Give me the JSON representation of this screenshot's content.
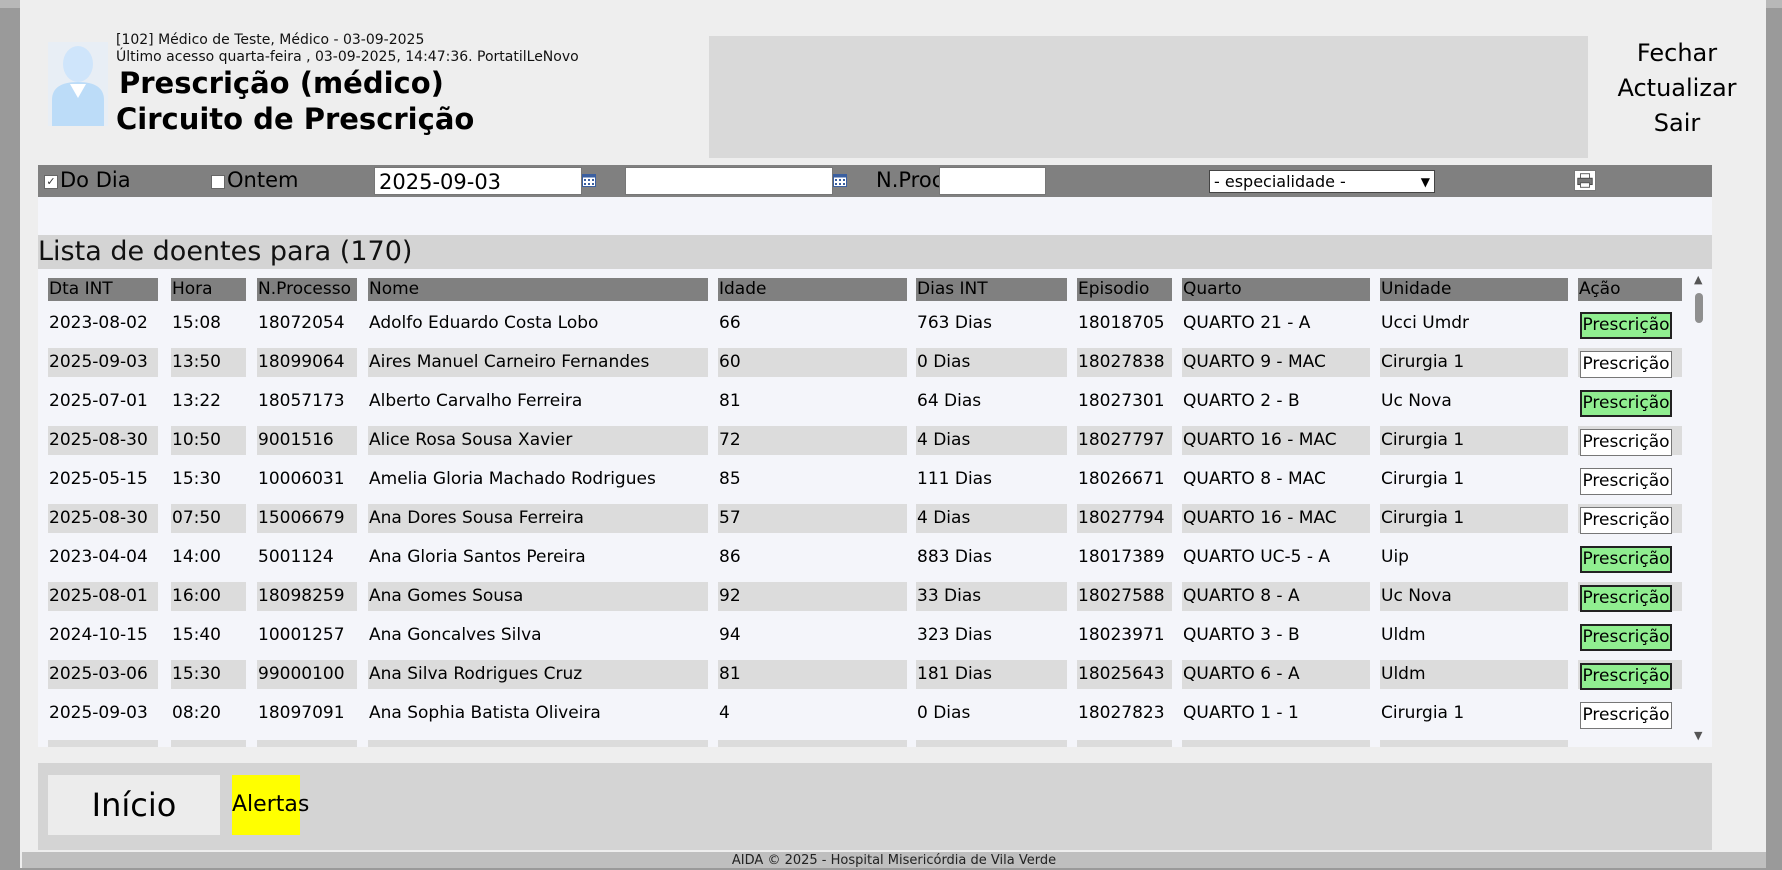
{
  "header": {
    "user_line": "[102] Médico de Teste, Médico - 03-09-2025",
    "last_access": "Último acesso quarta-feira , 03-09-2025, 14:47:36. PortatilLeNovo",
    "title": "Prescrição (médico)",
    "subtitle": "Circuito de Prescrição"
  },
  "top_menu": [
    "Fechar",
    "Actualizar",
    "Sair"
  ],
  "filters": {
    "do_dia_label": "Do Dia",
    "do_dia_checked": true,
    "ontem_label": "Ontem",
    "ontem_checked": false,
    "date_from": "2025-09-03",
    "date_to": "",
    "nproc_label": "N.Proc",
    "nproc_value": "",
    "especialidade": "- especialidade -"
  },
  "list": {
    "title": "Lista de doentes para (170)",
    "columns": [
      "Dta INT",
      "Hora",
      "N.Processo",
      "Nome",
      "Idade",
      "Dias INT",
      "Episodio",
      "Quarto",
      "Unidade",
      "Ação"
    ],
    "action_label": "Prescrição",
    "rows": [
      {
        "dta": "2023-08-02",
        "hora": "15:08",
        "nproc": "18072054",
        "nome": "Adolfo Eduardo Costa Lobo",
        "idade": "66",
        "dias": "763 Dias",
        "episodio": "18018705",
        "quarto": "QUARTO 21 - A",
        "unidade": "Ucci Umdr",
        "highlight": true
      },
      {
        "dta": "2025-09-03",
        "hora": "13:50",
        "nproc": "18099064",
        "nome": "Aires Manuel Carneiro Fernandes",
        "idade": "60",
        "dias": "0 Dias",
        "episodio": "18027838",
        "quarto": "QUARTO 9 - MAC",
        "unidade": "Cirurgia 1",
        "highlight": false
      },
      {
        "dta": "2025-07-01",
        "hora": "13:22",
        "nproc": "18057173",
        "nome": "Alberto Carvalho Ferreira",
        "idade": "81",
        "dias": "64 Dias",
        "episodio": "18027301",
        "quarto": "QUARTO 2 - B",
        "unidade": "Uc Nova",
        "highlight": true
      },
      {
        "dta": "2025-08-30",
        "hora": "10:50",
        "nproc": "9001516",
        "nome": "Alice Rosa Sousa Xavier",
        "idade": "72",
        "dias": "4 Dias",
        "episodio": "18027797",
        "quarto": "QUARTO 16 - MAC",
        "unidade": "Cirurgia 1",
        "highlight": false
      },
      {
        "dta": "2025-05-15",
        "hora": "15:30",
        "nproc": "10006031",
        "nome": "Amelia Gloria Machado Rodrigues",
        "idade": "85",
        "dias": "111 Dias",
        "episodio": "18026671",
        "quarto": "QUARTO 8 - MAC",
        "unidade": "Cirurgia 1",
        "highlight": false
      },
      {
        "dta": "2025-08-30",
        "hora": "07:50",
        "nproc": "15006679",
        "nome": "Ana Dores Sousa Ferreira",
        "idade": "57",
        "dias": "4 Dias",
        "episodio": "18027794",
        "quarto": "QUARTO 16 - MAC",
        "unidade": "Cirurgia 1",
        "highlight": false
      },
      {
        "dta": "2023-04-04",
        "hora": "14:00",
        "nproc": "5001124",
        "nome": "Ana Gloria Santos Pereira",
        "idade": "86",
        "dias": "883 Dias",
        "episodio": "18017389",
        "quarto": "QUARTO UC-5 - A",
        "unidade": "Uip",
        "highlight": true
      },
      {
        "dta": "2025-08-01",
        "hora": "16:00",
        "nproc": "18098259",
        "nome": "Ana Gomes Sousa",
        "idade": "92",
        "dias": "33 Dias",
        "episodio": "18027588",
        "quarto": "QUARTO 8 - A",
        "unidade": "Uc Nova",
        "highlight": true
      },
      {
        "dta": "2024-10-15",
        "hora": "15:40",
        "nproc": "10001257",
        "nome": "Ana Goncalves Silva",
        "idade": "94",
        "dias": "323 Dias",
        "episodio": "18023971",
        "quarto": "QUARTO 3 - B",
        "unidade": "Uldm",
        "highlight": true
      },
      {
        "dta": "2025-03-06",
        "hora": "15:30",
        "nproc": "99000100",
        "nome": "Ana Silva Rodrigues Cruz",
        "idade": "81",
        "dias": "181 Dias",
        "episodio": "18025643",
        "quarto": "QUARTO 6 - A",
        "unidade": "Uldm",
        "highlight": true
      },
      {
        "dta": "2025-09-03",
        "hora": "08:20",
        "nproc": "18097091",
        "nome": "Ana Sophia Batista Oliveira",
        "idade": "4",
        "dias": "0 Dias",
        "episodio": "18027823",
        "quarto": "QUARTO 1 - 1",
        "unidade": "Cirurgia 1",
        "highlight": false
      }
    ]
  },
  "bottom": {
    "inicio": "Início",
    "alertas": "Alertas"
  },
  "footer": "AIDA © 2025 - Hospital Misericórdia de Vila Verde",
  "colors": {
    "action_highlight": "#90ee90",
    "alert": "#ffff00",
    "bar": "#808080"
  }
}
